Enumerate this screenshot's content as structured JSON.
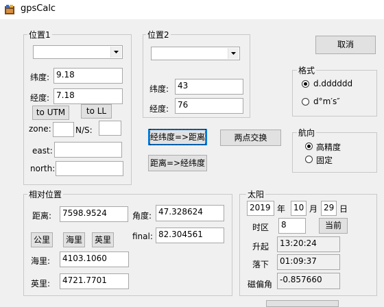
{
  "window": {
    "title": "gpsCalc"
  },
  "pos1": {
    "legend": "位置1",
    "dropdown_value": "",
    "lat_label": "纬度:",
    "lat_value": "9.18",
    "lon_label": "经度:",
    "lon_value": "7.18",
    "to_utm": "to UTM",
    "to_ll": "to LL",
    "zone_label": "zone:",
    "zone_value": "",
    "ns_label": "N/S:",
    "ns_value": "",
    "east_label": "east:",
    "east_value": "",
    "north_label": "north:",
    "north_value": ""
  },
  "pos2": {
    "legend": "位置2",
    "dropdown_value": "",
    "lat_label": "纬度:",
    "lat_value": "43",
    "lon_label": "经度:",
    "lon_value": "76"
  },
  "buttons": {
    "cancel": "取消",
    "latlon_to_dist": "经纬度=>距离",
    "swap": "两点交换",
    "dist_to_latlon": "距离=>经纬度"
  },
  "format": {
    "legend": "格式",
    "options": [
      "d.dddddd",
      "d°m′s″"
    ],
    "selected": 0
  },
  "heading": {
    "legend": "航向",
    "options": [
      "高精度",
      "固定"
    ],
    "selected": 0
  },
  "relative": {
    "legend": "相对位置",
    "distance_label": "距离:",
    "distance_value": "7598.9524",
    "angle_label": "角度:",
    "angle_value": "47.328624",
    "km_btn": "公里",
    "nmi_btn": "海里",
    "mile_btn": "英里",
    "final_label": "final:",
    "final_value": "82.304561",
    "nmi_label": "海里:",
    "nmi_value": "4103.1060",
    "mile_label": "英里:",
    "mile_value": "4721.7701"
  },
  "sun": {
    "legend": "太阳",
    "year": "2019",
    "year_unit": "年",
    "month": "10",
    "month_unit": "月",
    "day": "29",
    "day_unit": "日",
    "tz_label": "时区",
    "tz_value": "8",
    "now_btn": "当前",
    "rise_label": "升起",
    "rise_value": "13:20:24",
    "set_label": "落下",
    "set_value": "01:09:37",
    "decl_label": "磁偏角",
    "decl_value": "-0.857660"
  }
}
